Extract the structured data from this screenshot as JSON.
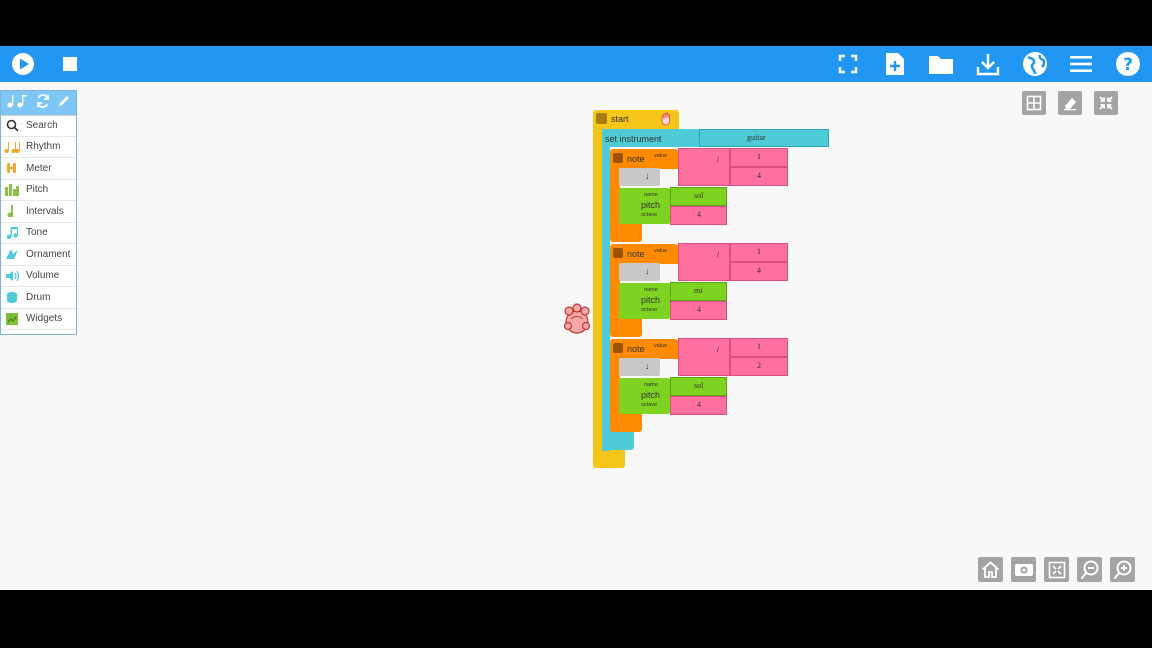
{
  "palette": {
    "header_icons": [
      "notes-icon",
      "refresh-icon",
      "pen-icon"
    ],
    "items": [
      {
        "label": "Search",
        "icon": "search-icon",
        "color": "#333333"
      },
      {
        "label": "Rhythm",
        "icon": "rhythm-icon",
        "color": "#f5a623"
      },
      {
        "label": "Meter",
        "icon": "meter-icon",
        "color": "#f5a623"
      },
      {
        "label": "Pitch",
        "icon": "pitch-icon",
        "color": "#8bc34a"
      },
      {
        "label": "Intervals",
        "icon": "intervals-icon",
        "color": "#8bc34a"
      },
      {
        "label": "Tone",
        "icon": "tone-icon",
        "color": "#4ecbd6"
      },
      {
        "label": "Ornament",
        "icon": "ornament-icon",
        "color": "#4ecbd6"
      },
      {
        "label": "Volume",
        "icon": "volume-icon",
        "color": "#4ecbd6"
      },
      {
        "label": "Drum",
        "icon": "drum-icon",
        "color": "#4ecbd6"
      },
      {
        "label": "Widgets",
        "icon": "widgets-icon",
        "color": "#7cbf3a"
      }
    ]
  },
  "program": {
    "start_label": "start",
    "set_instrument_label": "set instrument",
    "instrument": "guitar",
    "notes": [
      {
        "label": "note",
        "value_label": "value",
        "numerator": "1",
        "denominator": "4",
        "pitch_label": "pitch",
        "name_label": "name",
        "octave_label": "octave",
        "name": "sol",
        "octave": "4"
      },
      {
        "label": "note",
        "value_label": "value",
        "numerator": "1",
        "denominator": "4",
        "pitch_label": "pitch",
        "name_label": "name",
        "octave_label": "octave",
        "name": "mi",
        "octave": "4"
      },
      {
        "label": "note",
        "value_label": "value",
        "numerator": "1",
        "denominator": "2",
        "pitch_label": "pitch",
        "name_label": "name",
        "octave_label": "octave",
        "name": "sol",
        "octave": "4"
      }
    ],
    "arrow_glyph": "↓",
    "divide_glyph": "/"
  },
  "colors": {
    "toolbar": "#2196f3",
    "start": "#f5c518",
    "set_instrument": "#4ecbd6",
    "note": "#ff8a00",
    "value": "#ff6fa0",
    "pitch": "#7ed321",
    "hidden": "#c8c8c8"
  }
}
